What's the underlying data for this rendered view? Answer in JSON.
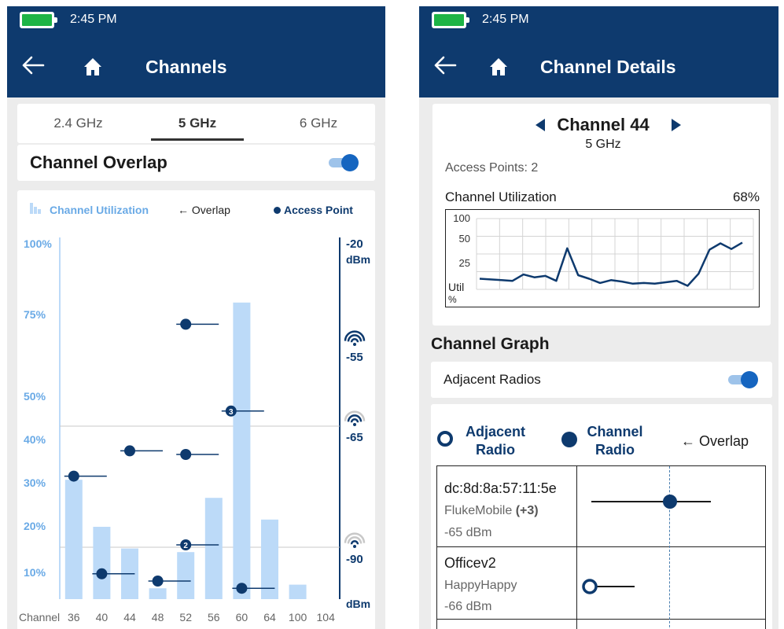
{
  "status": {
    "time": "2:45 PM"
  },
  "left": {
    "title": "Channels",
    "tabs": [
      {
        "label": "2.4 GHz",
        "active": false
      },
      {
        "label": "5 GHz",
        "active": true
      },
      {
        "label": "6 GHz",
        "active": false
      }
    ],
    "overlap_label": "Channel Overlap",
    "overlap_on": true,
    "legend": {
      "utilization": "Channel Utilization",
      "overlap": "← Overlap",
      "access_point": "Access Point"
    }
  },
  "right": {
    "title": "Channel Details",
    "channel": "Channel 44",
    "band": "5 GHz",
    "access_points": "Access Points: 2",
    "utilization_label": "Channel Utilization",
    "utilization_value": "68%",
    "graph_title": "Channel Graph",
    "adjacent_label": "Adjacent Radios",
    "adjacent_on": true,
    "legend": {
      "adjacent": [
        "Adjacent",
        "Radio"
      ],
      "channel": [
        "Channel",
        "Radio"
      ],
      "overlap": "← Overlap"
    },
    "radios": [
      {
        "name": "dc:8d:8a:57:11:5e",
        "vendor": "FlukeMobile",
        "extra": "(+3)",
        "rssi": "-65 dBm",
        "type": "channel"
      },
      {
        "name": "Officev2",
        "vendor": "HappyHappy",
        "extra": "",
        "rssi": "-66 dBm",
        "type": "adjacent"
      }
    ]
  },
  "colors": {
    "header": "#0e3a6e",
    "bar": "#bcdaf8",
    "accent": "#0e3a6e",
    "toggle": "#1565c0"
  },
  "chart_data": [
    {
      "type": "bar",
      "xlabel": "Channel",
      "categories": [
        "36",
        "40",
        "44",
        "48",
        "52",
        "56",
        "60",
        "64",
        "100",
        "104"
      ],
      "values": [
        33,
        20,
        14,
        3,
        13,
        28,
        82,
        22,
        4,
        0
      ],
      "y_ticks": [
        "100%",
        "75%",
        "50%",
        "40%",
        "30%",
        "20%",
        "10%"
      ],
      "y2_ticks": [
        "-20",
        "dBm",
        "-55",
        "-65",
        "-90",
        "dBm"
      ],
      "access_points": [
        {
          "channel": "36",
          "value": 34
        },
        {
          "channel": "40",
          "value": 7
        },
        {
          "channel": "44",
          "value": 41
        },
        {
          "channel": "48",
          "value": 5
        },
        {
          "channel": "52",
          "value": 76
        },
        {
          "channel": "52",
          "value": 40
        },
        {
          "channel": "56",
          "value": 52,
          "count": "3"
        },
        {
          "channel": "52",
          "value": 15,
          "count": "2"
        },
        {
          "channel": "60",
          "value": 3
        }
      ]
    },
    {
      "type": "line",
      "ylabel": "Util %",
      "y_ticks": [
        "100",
        "50",
        "25"
      ],
      "values": [
        15,
        14,
        13,
        12,
        21,
        17,
        19,
        12,
        58,
        20,
        15,
        9,
        13,
        11,
        8,
        9,
        8,
        10,
        12,
        5,
        22,
        56,
        65,
        57,
        66
      ]
    }
  ]
}
